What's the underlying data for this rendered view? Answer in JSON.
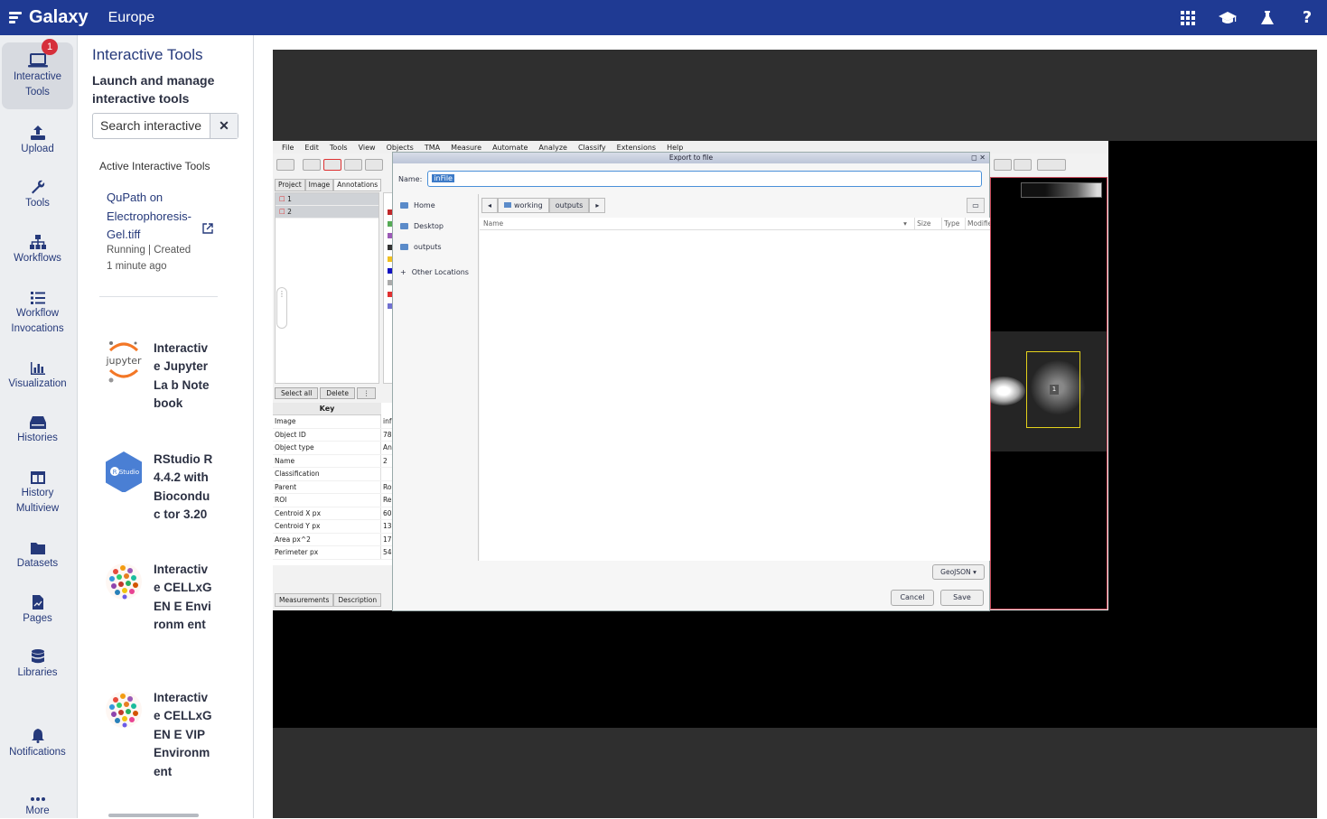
{
  "topbar": {
    "logo": "Galaxy",
    "brand": "Europe",
    "icons": [
      "grid-icon",
      "graduation-cap-icon",
      "flask-icon",
      "help-icon"
    ],
    "help_glyph": "?"
  },
  "activity_bar": {
    "items": [
      {
        "label_line1": "Interactive",
        "label_line2": "Tools",
        "icon": "laptop-icon",
        "badge": "1"
      },
      {
        "label_line1": "Upload",
        "label_line2": "",
        "icon": "upload-icon"
      },
      {
        "label_line1": "Tools",
        "label_line2": "",
        "icon": "wrench-icon"
      },
      {
        "label_line1": "Workflows",
        "label_line2": "",
        "icon": "sitemap-icon"
      },
      {
        "label_line1": "Workflow",
        "label_line2": "Invocations",
        "icon": "list-icon"
      },
      {
        "label_line1": "Visualization",
        "label_line2": "",
        "icon": "chart-bar-icon"
      },
      {
        "label_line1": "Histories",
        "label_line2": "",
        "icon": "hdd-icon"
      },
      {
        "label_line1": "History",
        "label_line2": "Multiview",
        "icon": "columns-icon"
      },
      {
        "label_line1": "Datasets",
        "label_line2": "",
        "icon": "folder-icon"
      },
      {
        "label_line1": "Pages",
        "label_line2": "",
        "icon": "file-chart-icon"
      },
      {
        "label_line1": "Libraries",
        "label_line2": "",
        "icon": "database-icon"
      },
      {
        "label_line1": "Notifications",
        "label_line2": "",
        "icon": "bell-icon"
      },
      {
        "label_line1": "More",
        "label_line2": "",
        "icon": "ellipsis-icon"
      }
    ]
  },
  "panel": {
    "title": "Interactive Tools",
    "subtitle": "Launch and manage interactive tools",
    "search_value": "Search interactive",
    "clear_glyph": "✕",
    "active_heading": "Active Interactive Tools",
    "active_tool": {
      "name": "QuPath on Electrophoresis-Gel.tiff",
      "status_line1": "Running | Created",
      "status_line2": "1 minute ago"
    },
    "tools": [
      {
        "name": "Interactiv e JupyterLa b Notebook",
        "icon": "jupyter-icon",
        "icon_text": "jupyter"
      },
      {
        "name": "RStudio R 4.4.2 with Bioconduc tor 3.20",
        "icon": "rstudio-icon",
        "icon_text": "Studio"
      },
      {
        "name": "Interactiv e CELLxGEN E Environm ent",
        "icon": "cellxgene-icon"
      },
      {
        "name": "Interactiv e CELLxGEN E VIP Environm ent",
        "icon": "cellxgene-icon"
      }
    ]
  },
  "qupath": {
    "menu": [
      "File",
      "Edit",
      "Tools",
      "View",
      "Objects",
      "TMA",
      "Measure",
      "Automate",
      "Analyze",
      "Classify",
      "Extensions",
      "Help"
    ],
    "left_tabs": [
      "Project",
      "Image",
      "Annotations"
    ],
    "annotations": [
      "1",
      "2"
    ],
    "buttons": [
      "Select all",
      "Delete",
      "⋮"
    ],
    "key_header": "Key",
    "keys": [
      {
        "k": "Image",
        "v": "inf"
      },
      {
        "k": "Object ID",
        "v": "78"
      },
      {
        "k": "Object type",
        "v": "An"
      },
      {
        "k": "Name",
        "v": "2"
      },
      {
        "k": "Classification",
        "v": ""
      },
      {
        "k": "Parent",
        "v": "Ro"
      },
      {
        "k": "ROI",
        "v": "Re"
      },
      {
        "k": "Centroid X px",
        "v": "60"
      },
      {
        "k": "Centroid Y px",
        "v": "13"
      },
      {
        "k": "Area px^2",
        "v": "17"
      },
      {
        "k": "Perimeter px",
        "v": "54"
      }
    ],
    "bottom_tabs": [
      "Measurements",
      "Description"
    ],
    "roi_label": "1",
    "swatch_colors": [
      "#c0282a",
      "#55aa55",
      "#9b59b6",
      "#333333",
      "#f0c020",
      "#1010c0",
      "#aaaaaa",
      "#e03030",
      "#7070d0"
    ]
  },
  "dialog": {
    "title": "Export to file",
    "name_label": "Name:",
    "name_value": "inFile",
    "places": [
      "Home",
      "Desktop",
      "outputs"
    ],
    "other_locations": "Other Locations",
    "path": [
      "working",
      "outputs"
    ],
    "columns": [
      "Name",
      "Size",
      "Type",
      "Modifie"
    ],
    "format": "GeoJSON",
    "cancel": "Cancel",
    "save": "Save"
  }
}
